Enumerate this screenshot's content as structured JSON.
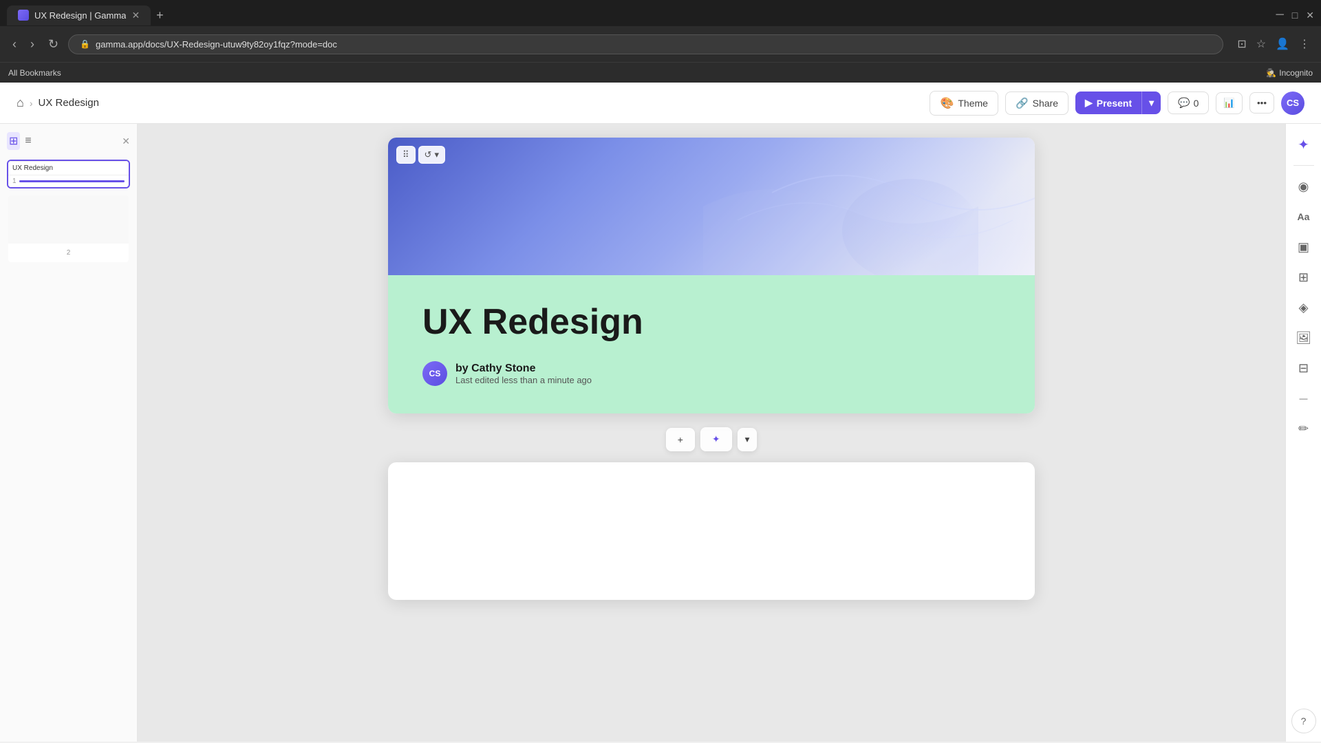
{
  "browser": {
    "tab_title": "UX Redesign | Gamma",
    "url": "gamma.app/docs/UX-Redesign-utuw9ty82oy1fqz?mode=doc",
    "bookmarks_label": "All Bookmarks",
    "incognito_label": "Incognito"
  },
  "header": {
    "home_icon": "⌂",
    "breadcrumb_sep": "›",
    "breadcrumb_title": "UX Redesign",
    "theme_label": "Theme",
    "share_label": "Share",
    "present_label": "Present",
    "comments_count": "0",
    "more_icon": "•••",
    "user_initials": "CS"
  },
  "slide_panel": {
    "slide1": {
      "title": "UX Redesign",
      "num": "1"
    },
    "slide2": {
      "num": "2"
    }
  },
  "slide": {
    "title": "UX Redesign",
    "author_name": "by Cathy Stone",
    "author_initials": "CS",
    "last_edited": "Last edited less than a minute ago"
  },
  "add_toolbar": {
    "add_label": "+",
    "ai_icon": "✦",
    "dropdown_icon": "▾"
  },
  "right_panel": {
    "ai_icon": "✦",
    "text_icon": "Aa",
    "card_icon": "▣",
    "layout_icon": "⊞",
    "color_icon": "◈",
    "image_icon": "⊡",
    "table_icon": "⊟",
    "divider_icon": "—",
    "draw_icon": "✏",
    "help_icon": "?"
  }
}
